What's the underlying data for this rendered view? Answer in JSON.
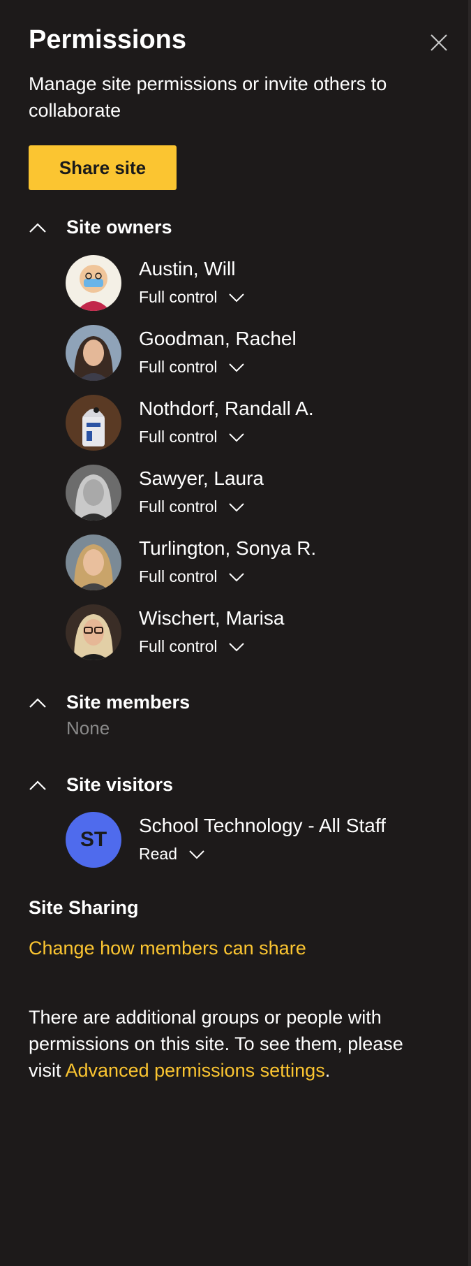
{
  "panel": {
    "title": "Permissions",
    "subtitle": "Manage site permissions or invite others to collaborate",
    "share_button": "Share site"
  },
  "sections": {
    "owners": {
      "label": "Site owners",
      "people": [
        {
          "name": "Austin, Will",
          "role": "Full control"
        },
        {
          "name": "Goodman, Rachel",
          "role": "Full control"
        },
        {
          "name": "Nothdorf, Randall A.",
          "role": "Full control"
        },
        {
          "name": "Sawyer, Laura",
          "role": "Full control"
        },
        {
          "name": "Turlington, Sonya R.",
          "role": "Full control"
        },
        {
          "name": "Wischert, Marisa",
          "role": "Full control"
        }
      ]
    },
    "members": {
      "label": "Site members",
      "empty_text": "None"
    },
    "visitors": {
      "label": "Site visitors",
      "people": [
        {
          "initials": "ST",
          "name": "School Technology - All Staff",
          "role": "Read"
        }
      ]
    }
  },
  "sharing": {
    "heading": "Site Sharing",
    "link": "Change how members can share"
  },
  "notice": {
    "text": "There are additional groups or people with permissions on this site. To see them, please visit ",
    "link": "Advanced permissions settings",
    "suffix": "."
  },
  "colors": {
    "background": "#1d1a1a",
    "accent": "#fbc531",
    "visitor_avatar": "#4f6bed",
    "muted": "#8a8a8a"
  },
  "icons": {
    "close": "close-icon",
    "collapse": "chevron-up-icon",
    "dropdown": "chevron-down-icon"
  }
}
